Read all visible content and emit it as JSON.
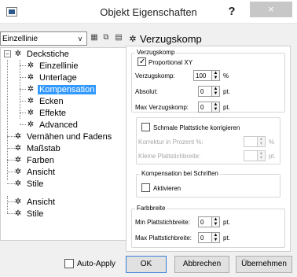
{
  "window": {
    "title": "Objekt Eigenschaften",
    "help": "?",
    "close": "×"
  },
  "toolbar": {
    "combo_value": "Einzellinie",
    "combo_arrow": "v"
  },
  "tree": {
    "items": [
      {
        "label": "Deckstiche"
      },
      {
        "label": "Einzellinie"
      },
      {
        "label": "Unterlage"
      },
      {
        "label": "Kompensation"
      },
      {
        "label": "Ecken"
      },
      {
        "label": "Effekte"
      },
      {
        "label": "Advanced"
      },
      {
        "label": "Vernähen und Fadens"
      },
      {
        "label": "Maßstab"
      },
      {
        "label": "Farben"
      },
      {
        "label": "Ansicht"
      },
      {
        "label": "Stile"
      },
      {
        "label": "Ansicht"
      },
      {
        "label": "Stile"
      }
    ]
  },
  "panel": {
    "title": "Verzugskomp",
    "group1": {
      "label": "Verzugskomp",
      "proportional_label": "Proportional XY",
      "verzugskomp": {
        "label": "Verzugskomp:",
        "value": "100",
        "unit": "%"
      },
      "absolut": {
        "label": "Absolut:",
        "value": "0",
        "unit": "pt."
      },
      "max": {
        "label": "Max Verzugskomp:",
        "value": "0",
        "unit": "pt."
      }
    },
    "schmale": {
      "label": "Schmale Plattstiche korrigieren",
      "korrektur": {
        "label": "Korrektur in Prozent %:",
        "unit": "%"
      },
      "kleine": {
        "label": "Kleine Plattstichbreite:",
        "unit": "pt."
      }
    },
    "schriften": {
      "label": "Kompensation bei Schriften",
      "aktivieren": "Aktivieren"
    },
    "farbbreite": {
      "label": "Farbbreite",
      "min": {
        "label": "Min Plattstichbreite:",
        "value": "0",
        "unit": "pt."
      },
      "max": {
        "label": "Max Plattstichbreite:",
        "value": "0",
        "unit": "pt."
      }
    }
  },
  "buttons": {
    "auto_apply": "Auto-Apply",
    "ok": "OK",
    "cancel": "Abbrechen",
    "apply": "Übernehmen"
  },
  "colors": {
    "selection": "#3399ff",
    "close_button": "#c7c7c7"
  }
}
